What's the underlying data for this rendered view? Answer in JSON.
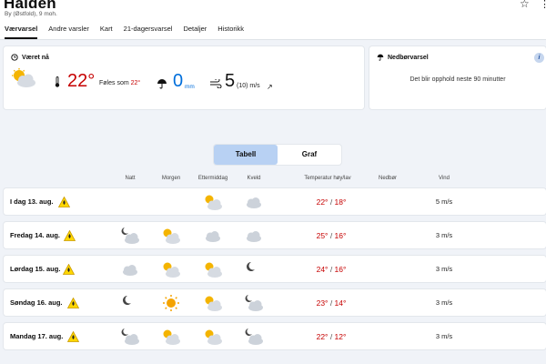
{
  "header": {
    "title": "Halden",
    "subtitle": "By (Østfold), 9 moh.",
    "star_icon": "star-outline-icon",
    "tabs": [
      {
        "label": "Værvarsel",
        "active": true
      },
      {
        "label": "Andre varsler",
        "active": false
      },
      {
        "label": "Kart",
        "active": false
      },
      {
        "label": "21-dagersvarsel",
        "active": false
      },
      {
        "label": "Detaljer",
        "active": false
      },
      {
        "label": "Historikk",
        "active": false
      }
    ]
  },
  "now": {
    "title": "Været nå",
    "temperature": "22°",
    "feels_label": "Føles som",
    "feels_value": "22°",
    "precip_value": "0",
    "precip_unit": "mm",
    "wind_value": "5",
    "wind_detail": "(10) m/s",
    "wind_arrow": "↗",
    "weather_icon": "partly-cloudy-icon"
  },
  "nowcast": {
    "title": "Nedbørvarsel",
    "text": "Det blir opphold neste 90 minutter",
    "info": "i"
  },
  "toggle": {
    "table_label": "Tabell",
    "graph_label": "Graf"
  },
  "columns": {
    "night": "Natt",
    "morning": "Morgen",
    "afternoon": "Ettermiddag",
    "evening": "Kveld",
    "temp": "Temperatur høy/lav",
    "precip": "Nedbør",
    "wind": "Vind"
  },
  "days": [
    {
      "label": "I dag 13. aug.",
      "icons": [
        "",
        "",
        "partly-cloudy",
        "cloudy"
      ],
      "high": "22°",
      "low": "18°",
      "wind": "5 m/s"
    },
    {
      "label": "Fredag 14. aug.",
      "icons": [
        "partly-cloudy-night",
        "partly-cloudy",
        "cloudy",
        "cloudy"
      ],
      "high": "25°",
      "low": "16°",
      "wind": "3 m/s"
    },
    {
      "label": "Lørdag 15. aug.",
      "icons": [
        "cloudy",
        "partly-cloudy",
        "partly-cloudy",
        "moon"
      ],
      "high": "24°",
      "low": "16°",
      "wind": "3 m/s"
    },
    {
      "label": "Søndag 16. aug.",
      "icons": [
        "moon",
        "sun",
        "partly-cloudy",
        "partly-cloudy-night"
      ],
      "high": "23°",
      "low": "14°",
      "wind": "3 m/s"
    },
    {
      "label": "Mandag 17. aug.",
      "icons": [
        "partly-cloudy-night",
        "partly-cloudy",
        "partly-cloudy",
        "partly-cloudy-night"
      ],
      "high": "22°",
      "low": "12°",
      "wind": "3 m/s"
    }
  ],
  "colors": {
    "warm": "#c60000",
    "precip": "#006edb",
    "accent": "#b8d1f3",
    "warning": "#ffd700"
  }
}
